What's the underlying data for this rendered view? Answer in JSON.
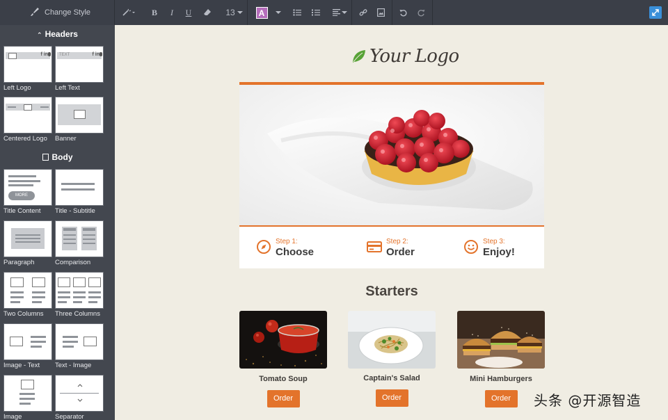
{
  "toolbar": {
    "change_style_label": "Change Style",
    "font_size": "13",
    "text_color_letter": "A",
    "text_color": "#b56dbb",
    "accent": "#3a8fd9"
  },
  "sidebar": {
    "headers_title": "Headers",
    "body_title": "Body",
    "header_blocks": [
      {
        "label": "Left Logo"
      },
      {
        "label": "Left Text",
        "thumb_text": "TEXT"
      },
      {
        "label": "Centered Logo"
      },
      {
        "label": "Banner"
      }
    ],
    "body_blocks": [
      {
        "label": "Title Content",
        "thumb_button": "MORE"
      },
      {
        "label": "Title - Subtitle"
      },
      {
        "label": "Paragraph"
      },
      {
        "label": "Comparison"
      },
      {
        "label": "Two Columns"
      },
      {
        "label": "Three Columns"
      },
      {
        "label": "Image - Text"
      },
      {
        "label": "Text - Image"
      },
      {
        "label": "Image"
      },
      {
        "label": "Separator"
      }
    ],
    "social_marks": "f in"
  },
  "email": {
    "logo_text": "Your Logo",
    "brand_color": "#e3732b",
    "steps": [
      {
        "small": "Step 1:",
        "big": "Choose",
        "icon": "compass-icon"
      },
      {
        "small": "Step 2:",
        "big": "Order",
        "icon": "credit-card-icon"
      },
      {
        "small": "Step 3:",
        "big": "Enjoy!",
        "icon": "smiley-icon"
      }
    ],
    "section_title": "Starters",
    "products": [
      {
        "name": "Tomato Soup",
        "button": "Order"
      },
      {
        "name": "Captain's Salad",
        "button": "Order"
      },
      {
        "name": "Mini Hamburgers",
        "button": "Order"
      }
    ]
  },
  "watermark": "头条 @开源智造"
}
